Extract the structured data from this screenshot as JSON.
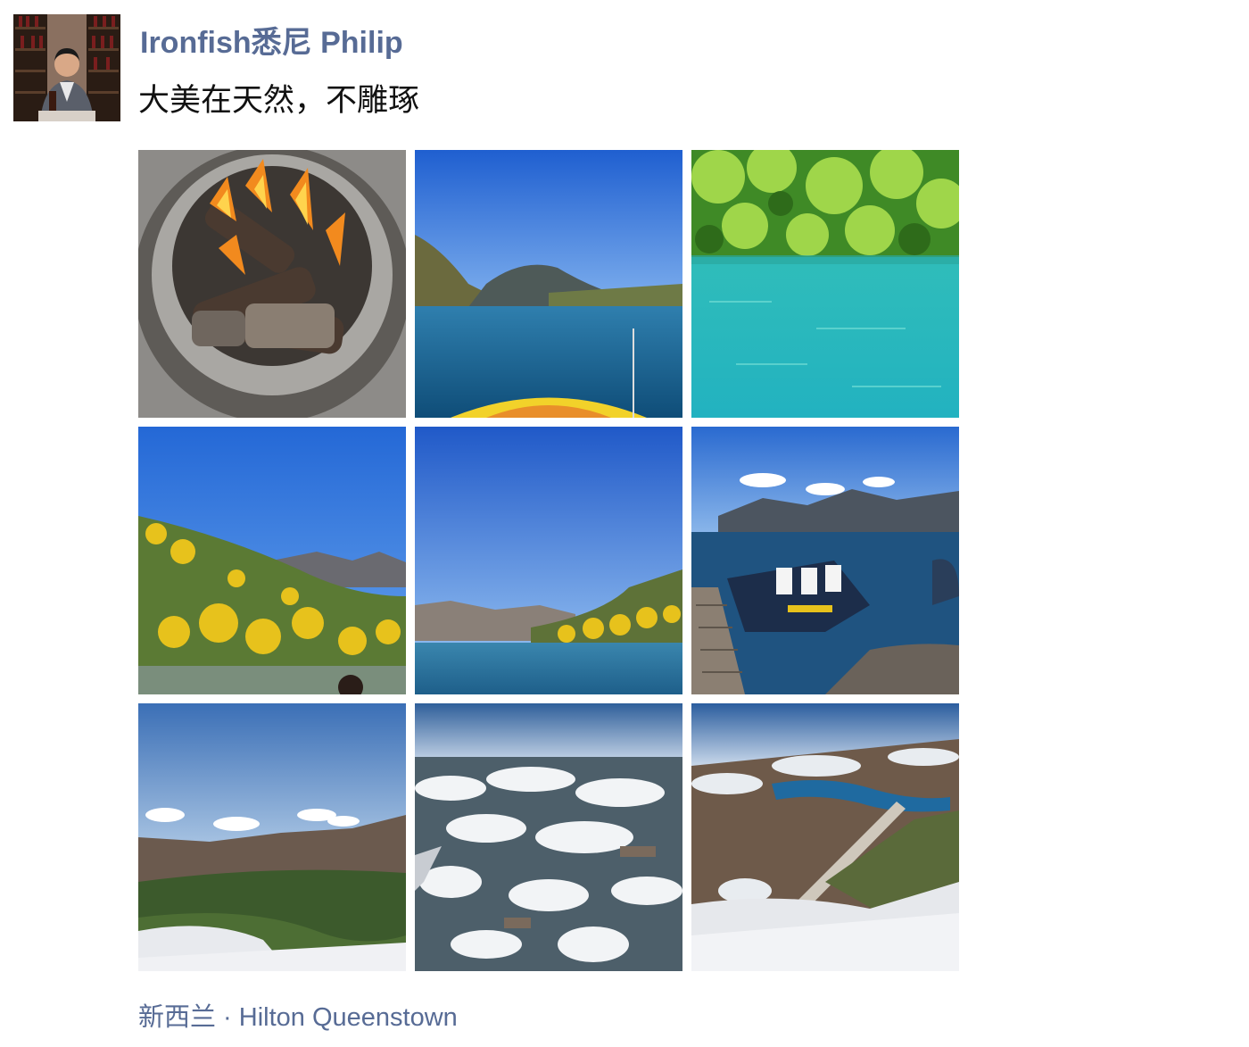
{
  "post": {
    "author": "Ironfish悉尼 Philip",
    "text": "大美在天然，不雕琢",
    "location": "新西兰 · Hilton Queenstown"
  },
  "photos": [
    {
      "subject": "fire-pit"
    },
    {
      "subject": "river-boat-bow"
    },
    {
      "subject": "turquoise-lake-forest"
    },
    {
      "subject": "yellow-gorse-hillside"
    },
    {
      "subject": "river-valley-sky"
    },
    {
      "subject": "jet-boat-dock"
    },
    {
      "subject": "aerial-valley-wing"
    },
    {
      "subject": "aerial-snow-mountains"
    },
    {
      "subject": "aerial-lake-wing"
    }
  ],
  "colors": {
    "link": "#576b95",
    "text": "#111111",
    "background": "#ffffff"
  }
}
